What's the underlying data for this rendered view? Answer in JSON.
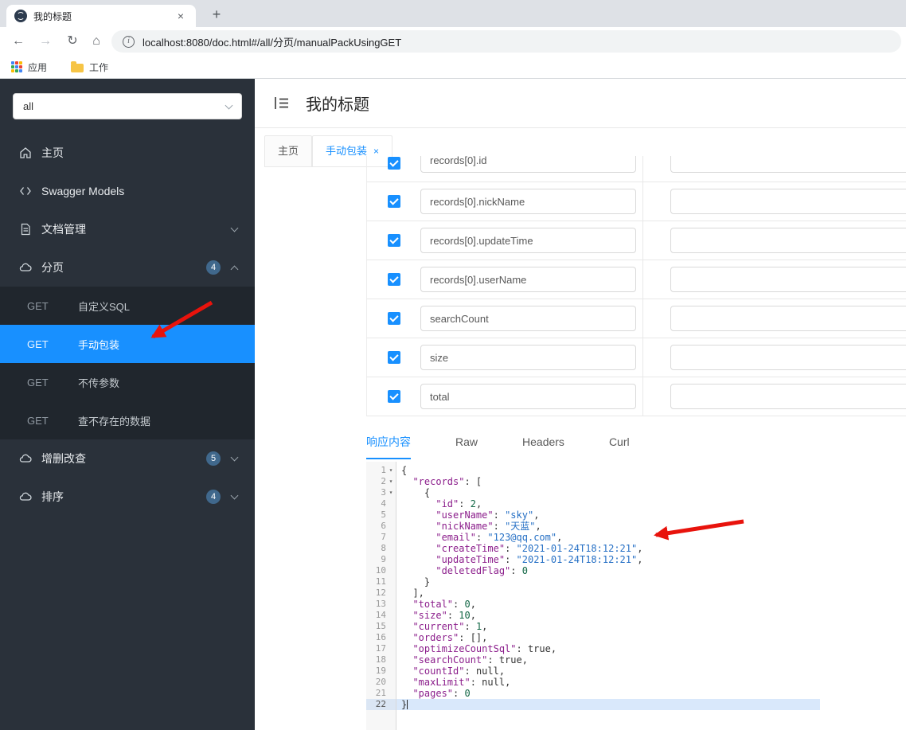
{
  "colors": {
    "accent": "#1890ff",
    "sidebar_bg": "#2a313a",
    "sidebar_submenu_bg": "#20262d",
    "selected_item": "#1890ff",
    "badge": "#40688c",
    "annotation_arrow": "#e8130c",
    "code_key": "#8b1d8b",
    "code_string": "#2670c5",
    "code_number": "#116644"
  },
  "icons": {
    "close": "×",
    "new_tab": "+",
    "back": "←",
    "forward": "→",
    "reload": "↻",
    "home": "⌂",
    "info": "i",
    "fold_marker": "▾"
  },
  "browser": {
    "tab": {
      "title": "我的标题"
    },
    "url": "localhost:8080/doc.html#/all/分页/manualPackUsingGET",
    "bookmarks": {
      "apps_label": "应用",
      "folder_label": "工作"
    }
  },
  "sidebar": {
    "filter_select": {
      "value": "all"
    },
    "items": [
      {
        "label": "主页"
      },
      {
        "label": "Swagger Models"
      },
      {
        "label": "文档管理"
      },
      {
        "label": "分页",
        "badge": "4"
      },
      {
        "label": "增删改查",
        "badge": "5"
      },
      {
        "label": "排序",
        "badge": "4"
      }
    ],
    "api_list": [
      {
        "method": "GET",
        "label": "自定义SQL"
      },
      {
        "method": "GET",
        "label": "手动包装"
      },
      {
        "method": "GET",
        "label": "不传参数"
      },
      {
        "method": "GET",
        "label": "查不存在的数据"
      }
    ]
  },
  "header": {
    "title": "我的标题"
  },
  "doc_tabs": [
    {
      "label": "主页"
    },
    {
      "label": "手动包装",
      "close": "×"
    }
  ],
  "params": {
    "partial_row": {
      "name": "records[0].id",
      "value": ""
    },
    "rows": [
      {
        "name": "records[0].nickName",
        "value": ""
      },
      {
        "name": "records[0].updateTime",
        "value": ""
      },
      {
        "name": "records[0].userName",
        "value": ""
      },
      {
        "name": "searchCount",
        "value": ""
      },
      {
        "name": "size",
        "value": ""
      },
      {
        "name": "total",
        "value": ""
      }
    ]
  },
  "response": {
    "tabs": [
      "响应内容",
      "Raw",
      "Headers",
      "Curl"
    ],
    "active_tab": "响应内容",
    "fold_lines": [
      1,
      2,
      3
    ],
    "active_line": 22,
    "code_lines": [
      "{",
      "  \"records\": [",
      "    {",
      "      \"id\": 2,",
      "      \"userName\": \"sky\",",
      "      \"nickName\": \"天蓝\",",
      "      \"email\": \"123@qq.com\",",
      "      \"createTime\": \"2021-01-24T18:12:21\",",
      "      \"updateTime\": \"2021-01-24T18:12:21\",",
      "      \"deletedFlag\": 0",
      "    }",
      "  ],",
      "  \"total\": 0,",
      "  \"size\": 10,",
      "  \"current\": 1,",
      "  \"orders\": [],",
      "  \"optimizeCountSql\": true,",
      "  \"searchCount\": true,",
      "  \"countId\": null,",
      "  \"maxLimit\": null,",
      "  \"pages\": 0",
      "}"
    ]
  }
}
